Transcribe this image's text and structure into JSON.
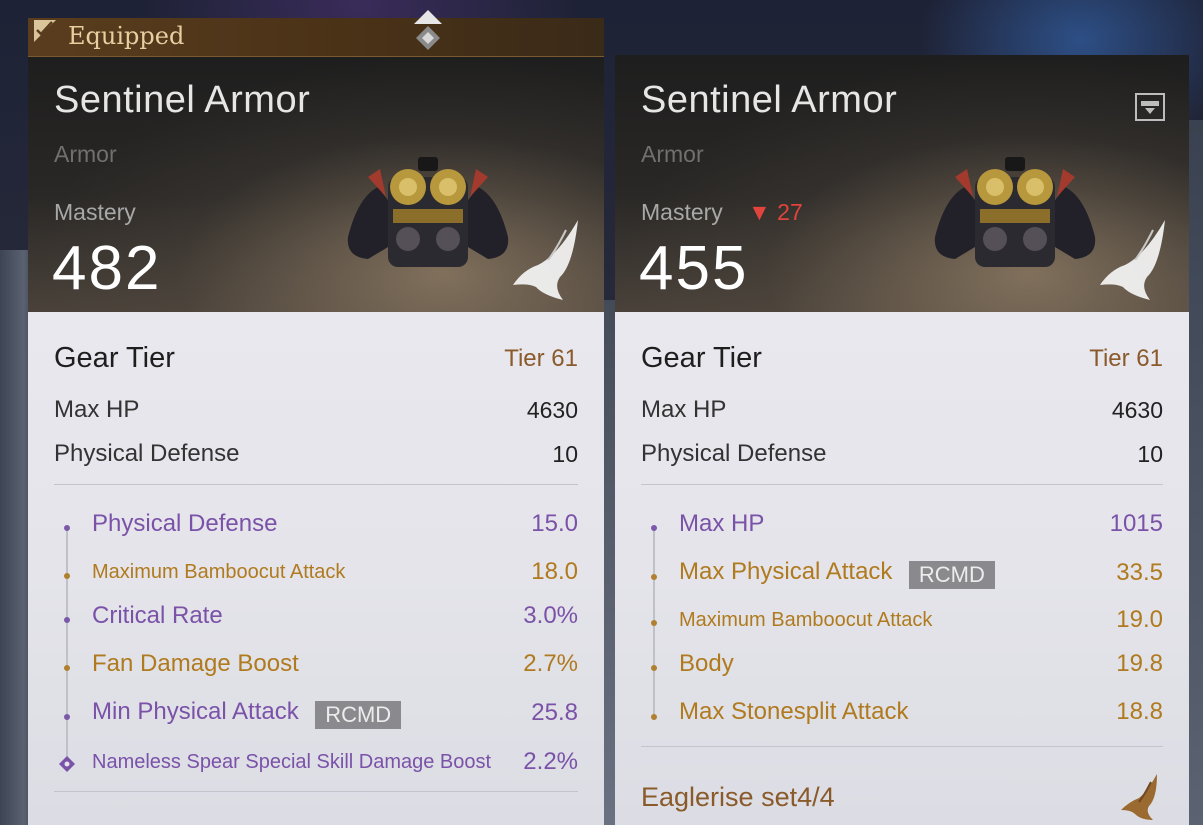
{
  "equipped_label": "Equipped",
  "colors": {
    "stat_purple": "#7a52a8",
    "stat_gold": "#b07a1e",
    "mastery_down": "#e0443c",
    "tier_text": "#8a5a2a"
  },
  "left": {
    "title": "Sentinel Armor",
    "subtitle": "Armor",
    "mastery_label": "Mastery",
    "mastery_value": "482",
    "gear_tier_label": "Gear Tier",
    "gear_tier_value": "Tier 61",
    "base_stats": [
      {
        "label": "Max HP",
        "value": "4630"
      },
      {
        "label": "Physical Defense",
        "value": "10"
      }
    ],
    "sub_stats": [
      {
        "label": "Physical Defense",
        "value": "15.0",
        "color": "purple"
      },
      {
        "label": "Maximum Bamboocut Attack",
        "value": "18.0",
        "color": "gold"
      },
      {
        "label": "Critical Rate",
        "value": "3.0%",
        "color": "purple"
      },
      {
        "label": "Fan Damage Boost",
        "value": "2.7%",
        "color": "gold"
      },
      {
        "label": "Min Physical Attack",
        "value": "25.8",
        "color": "purple",
        "badge": "RCMD"
      },
      {
        "label": "Nameless Spear Special Skill Damage Boost",
        "value": "2.2%",
        "color": "purple"
      }
    ]
  },
  "right": {
    "title": "Sentinel Armor",
    "subtitle": "Armor",
    "mastery_label": "Mastery",
    "mastery_diff": "▼ 27",
    "mastery_value": "455",
    "gear_tier_label": "Gear Tier",
    "gear_tier_value": "Tier 61",
    "base_stats": [
      {
        "label": "Max HP",
        "value": "4630"
      },
      {
        "label": "Physical Defense",
        "value": "10"
      }
    ],
    "sub_stats": [
      {
        "label": "Max HP",
        "value": "1015",
        "color": "purple"
      },
      {
        "label": "Max Physical Attack",
        "value": "33.5",
        "color": "gold",
        "badge": "RCMD"
      },
      {
        "label": "Maximum Bamboocut Attack",
        "value": "19.0",
        "color": "gold"
      },
      {
        "label": "Body",
        "value": "19.8",
        "color": "gold"
      },
      {
        "label": "Max Stonesplit Attack",
        "value": "18.8",
        "color": "gold"
      }
    ],
    "set_label": "Eaglerise set4/4"
  }
}
